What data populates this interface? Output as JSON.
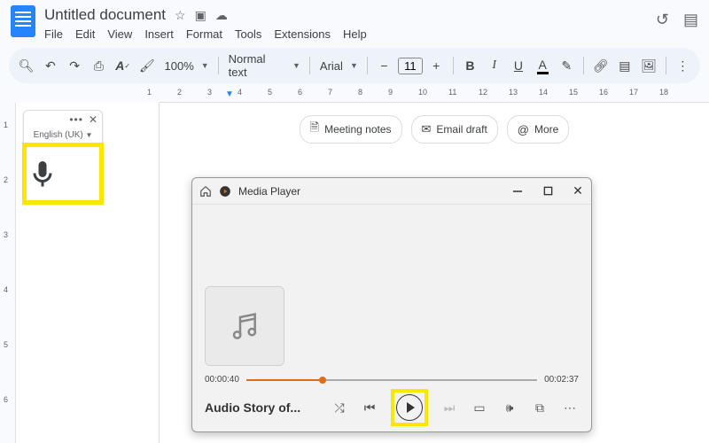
{
  "doc": {
    "title": "Untitled document"
  },
  "menu": {
    "file": "File",
    "edit": "Edit",
    "view": "View",
    "insert": "Insert",
    "format": "Format",
    "tools": "Tools",
    "extensions": "Extensions",
    "help": "Help"
  },
  "toolbar": {
    "zoom": "100%",
    "style": "Normal text",
    "font": "Arial",
    "size": "11",
    "minus": "−",
    "plus": "+"
  },
  "ruler": {
    "marks": [
      "1",
      "2",
      "3",
      "4",
      "5",
      "6",
      "7",
      "8",
      "9",
      "10",
      "11",
      "12",
      "13",
      "14",
      "15",
      "16",
      "17",
      "18"
    ]
  },
  "vruler": {
    "marks": [
      "1",
      "2",
      "3",
      "4",
      "5",
      "6"
    ]
  },
  "voice": {
    "lang": "English (UK)"
  },
  "chips": {
    "notes": "Meeting notes",
    "email": "Email draft",
    "more": "More"
  },
  "mediaplayer": {
    "app_name": "Media Player",
    "elapsed": "00:00:40",
    "total": "00:02:37",
    "track": "Audio Story of..."
  }
}
